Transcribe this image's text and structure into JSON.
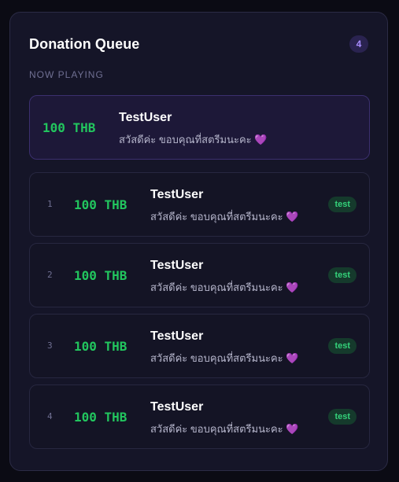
{
  "header": {
    "title": "Donation Queue",
    "count": "4"
  },
  "now_playing": {
    "label": "NOW PLAYING",
    "amount": "100 THB",
    "name": "TestUser",
    "message": "สวัสดีค่ะ ขอบคุณที่สตรีมนะคะ",
    "heart_icon": "💜"
  },
  "queue": [
    {
      "position": "1",
      "amount": "100 THB",
      "name": "TestUser",
      "message": "สวัสดีค่ะ ขอบคุณที่สตรีมนะคะ",
      "heart_icon": "💜",
      "tag": "test"
    },
    {
      "position": "2",
      "amount": "100 THB",
      "name": "TestUser",
      "message": "สวัสดีค่ะ ขอบคุณที่สตรีมนะคะ",
      "heart_icon": "💜",
      "tag": "test"
    },
    {
      "position": "3",
      "amount": "100 THB",
      "name": "TestUser",
      "message": "สวัสดีค่ะ ขอบคุณที่สตรีมนะคะ",
      "heart_icon": "💜",
      "tag": "test"
    },
    {
      "position": "4",
      "amount": "100 THB",
      "name": "TestUser",
      "message": "สวัสดีค่ะ ขอบคุณที่สตรีมนะคะ",
      "heart_icon": "💜",
      "tag": "test"
    }
  ],
  "colors": {
    "amount": "#22c55e",
    "accent": "#a88cff",
    "tag": "#34d27a",
    "heart": "#a864e8"
  }
}
